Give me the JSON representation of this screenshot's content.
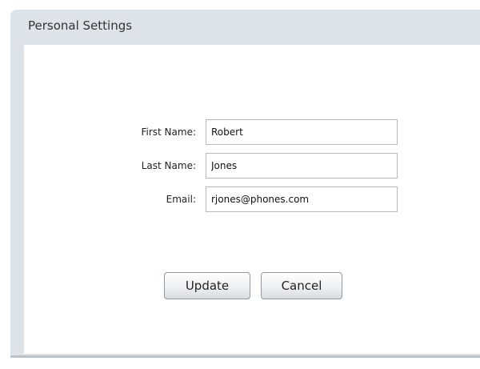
{
  "panel": {
    "title": "Personal Settings"
  },
  "form": {
    "first_name": {
      "label": "First Name:",
      "value": "Robert"
    },
    "last_name": {
      "label": "Last Name:",
      "value": "Jones"
    },
    "email": {
      "label": "Email:",
      "value": "rjones@phones.com"
    }
  },
  "actions": {
    "update_label": "Update",
    "cancel_label": "Cancel"
  }
}
